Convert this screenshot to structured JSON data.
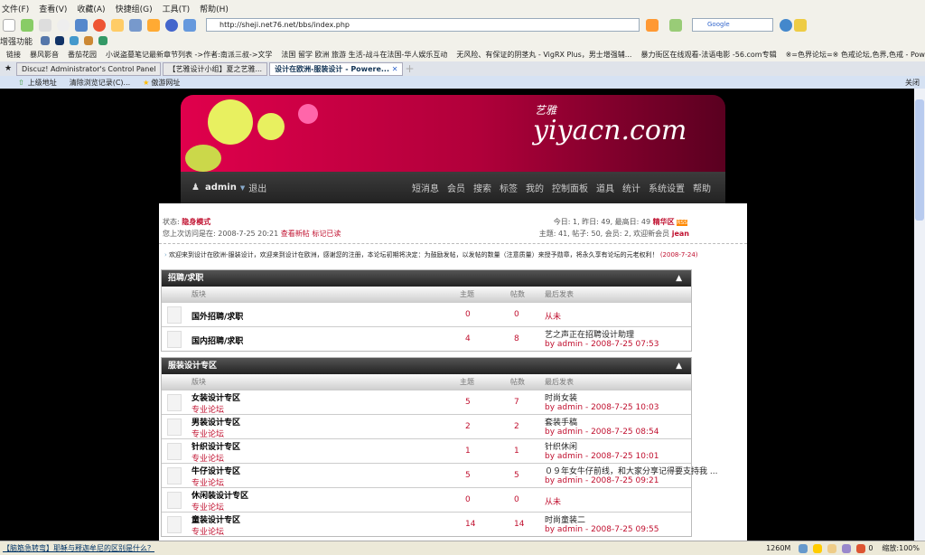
{
  "browser": {
    "menu": [
      "文件(F)",
      "查看(V)",
      "收藏(A)",
      "快捷组(G)",
      "工具(T)",
      "帮助(H)"
    ],
    "url": "http://sheji.net76.net/bbs/index.php",
    "search_engine": "Google",
    "enhance_label": "增强功能",
    "bookmarks": [
      "链接",
      "暴风影音",
      "番茄花园",
      "小说盗墓笔记最新章节列表 ->作者:南派三叔->文学",
      "法国 留学 欧洲 旅游 生活-战斗在法国-华人娱乐互动",
      "无风险、有保证的阴茎丸 - VigRX Plus，男士增强辅...",
      "暴力街区在线观看-法语电影 -56.com专辑",
      "※=色界论坛=※ 色戒论坛,色界,色戒 - Powered ..."
    ],
    "tabs": [
      "Discuz! Administrator's Control Panel",
      "【艺雅设计小组】夏之艺雅...",
      "设计在欧洲-服装设计 - Powere..."
    ],
    "addr_bar": [
      "上级地址",
      "清除浏览记录(C)...",
      "傲游网址"
    ],
    "close_label": "关闭",
    "status_text": "【脑筋急转弯】耶稣与释迦牟尼的区别是什么？",
    "status_mem": "1260M",
    "status_zoom": "缩放:100%",
    "status_count": "0"
  },
  "site": {
    "logo": "yiyacn.com",
    "logo_sub": "艺雅",
    "user": "admin",
    "logout": "退出",
    "nav": [
      "短消息",
      "会员",
      "搜索",
      "标签",
      "我的",
      "控制面板",
      "道具",
      "统计",
      "系统设置",
      "帮助"
    ]
  },
  "info": {
    "status_label": "状态:",
    "status_value": "隐身模式",
    "last_visit": "您上次访问是在: 2008-7-25 20:21",
    "view_new": "查看新帖",
    "mark_read": "标记已读",
    "stats1": "今日: 1, 昨日: 49, 最高日: 49",
    "digest": "精华区",
    "stats2": "主题: 41, 帖子: 50, 会员: 2, 欢迎新会员",
    "newest": "jean",
    "announce": "欢迎来到设计在欧洲-服装设计，欢迎来到设计在欧洲，感谢您的注册，本论坛初期将决定：为鼓励发帖，以发帖的数量（注意质量）来授予勋章，将永久享有论坛的元老权利！",
    "announce_date": "(2008-7-24)"
  },
  "columns": {
    "forum": "版块",
    "topics": "主题",
    "posts": "帖数",
    "last": "最后发表"
  },
  "categories": [
    {
      "title": "招聘/求职",
      "forums": [
        {
          "name": "国外招聘/求职",
          "mod": "",
          "topics": "0",
          "posts": "0",
          "last_title": "从未",
          "last_by": ""
        },
        {
          "name": "国内招聘/求职",
          "mod": "",
          "topics": "4",
          "posts": "8",
          "last_title": "艺之声正在招聘设计助理",
          "last_by": "by admin - 2008-7-25 07:53"
        }
      ]
    },
    {
      "title": "服装设计专区",
      "forums": [
        {
          "name": "女装设计专区",
          "mod": "专业论坛",
          "topics": "5",
          "posts": "7",
          "last_title": "时尚女装",
          "last_by": "by admin - 2008-7-25 10:03"
        },
        {
          "name": "男装设计专区",
          "mod": "专业论坛",
          "topics": "2",
          "posts": "2",
          "last_title": "套装手稿",
          "last_by": "by admin - 2008-7-25 08:54"
        },
        {
          "name": "针织设计专区",
          "mod": "专业论坛",
          "topics": "1",
          "posts": "1",
          "last_title": "针织休闲",
          "last_by": "by admin - 2008-7-25 10:01"
        },
        {
          "name": "牛仔设计专区",
          "mod": "专业论坛",
          "topics": "5",
          "posts": "5",
          "last_title": "０９年女牛仔前线，和大家分享记得要支持我 ...",
          "last_by": "by admin - 2008-7-25 09:21"
        },
        {
          "name": "休闲装设计专区",
          "mod": "专业论坛",
          "topics": "0",
          "posts": "0",
          "last_title": "从未",
          "last_by": ""
        },
        {
          "name": "童装设计专区",
          "mod": "专业论坛",
          "topics": "14",
          "posts": "14",
          "last_title": "时尚童装二",
          "last_by": "by admin - 2008-7-25 09:55"
        }
      ]
    }
  ]
}
